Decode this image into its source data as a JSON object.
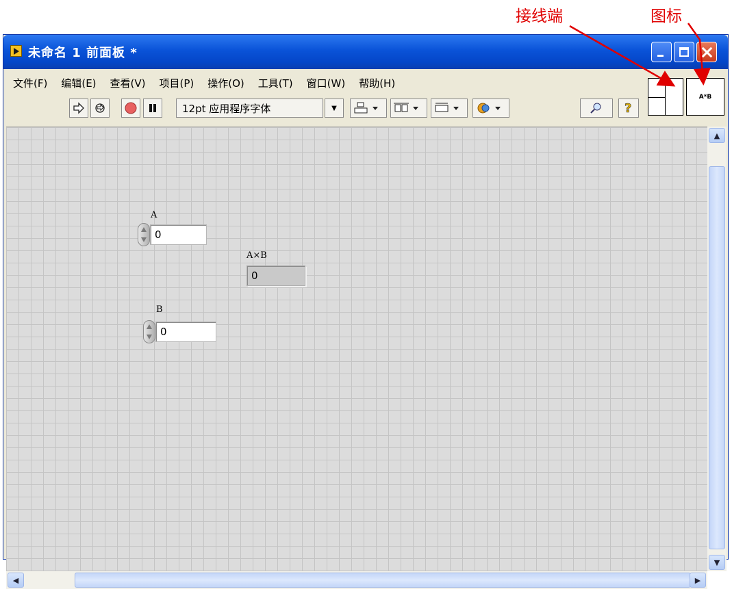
{
  "annotations": {
    "connector_label": "接线端",
    "icon_label": "图标"
  },
  "window": {
    "title": "未命名 1 前面板 *"
  },
  "menu": [
    "文件(F)",
    "编辑(E)",
    "查看(V)",
    "项目(P)",
    "操作(O)",
    "工具(T)",
    "窗口(W)",
    "帮助(H)"
  ],
  "toolbar": {
    "font": "12pt 应用程序字体"
  },
  "vi_icon_text": "A*B",
  "controls": {
    "a": {
      "label": "A",
      "value": "0"
    },
    "b": {
      "label": "B",
      "value": "0"
    }
  },
  "indicator": {
    "label": "A×B",
    "value": "0"
  },
  "colors": {
    "annotation": "#e00000",
    "titlebar": "#0a53d8",
    "panel_grid": "#dcdcdc"
  }
}
